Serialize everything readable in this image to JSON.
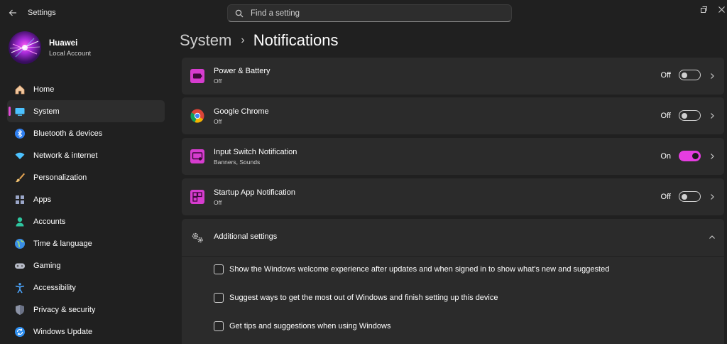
{
  "window": {
    "title": "Settings"
  },
  "search": {
    "placeholder": "Find a setting"
  },
  "profile": {
    "name": "Huawei",
    "account_type": "Local Account"
  },
  "sidebar": {
    "items": [
      {
        "label": "Home",
        "icon": "home-icon"
      },
      {
        "label": "System",
        "icon": "system-icon",
        "active": true
      },
      {
        "label": "Bluetooth & devices",
        "icon": "bluetooth-icon"
      },
      {
        "label": "Network & internet",
        "icon": "wifi-icon"
      },
      {
        "label": "Personalization",
        "icon": "brush-icon"
      },
      {
        "label": "Apps",
        "icon": "apps-icon"
      },
      {
        "label": "Accounts",
        "icon": "account-icon"
      },
      {
        "label": "Time & language",
        "icon": "globe-icon"
      },
      {
        "label": "Gaming",
        "icon": "gamepad-icon"
      },
      {
        "label": "Accessibility",
        "icon": "accessibility-icon"
      },
      {
        "label": "Privacy & security",
        "icon": "shield-icon"
      },
      {
        "label": "Windows Update",
        "icon": "update-icon"
      }
    ]
  },
  "breadcrumb": {
    "parent": "System",
    "separator": "›",
    "current": "Notifications"
  },
  "apps": [
    {
      "name": "Power & Battery",
      "detail": "Off",
      "state": "Off",
      "enabled": false,
      "icon": "battery-icon"
    },
    {
      "name": "Google Chrome",
      "detail": "Off",
      "state": "Off",
      "enabled": false,
      "icon": "chrome-icon"
    },
    {
      "name": "Input Switch Notification",
      "detail": "Banners, Sounds",
      "state": "On",
      "enabled": true,
      "icon": "input-switch-icon"
    },
    {
      "name": "Startup App Notification",
      "detail": "Off",
      "state": "Off",
      "enabled": false,
      "icon": "startup-app-icon"
    }
  ],
  "additional": {
    "title": "Additional settings",
    "options": [
      {
        "label": "Show the Windows welcome experience after updates and when signed in to show what's new and suggested",
        "checked": false
      },
      {
        "label": "Suggest ways to get the most out of Windows and finish setting up this device",
        "checked": false
      },
      {
        "label": "Get tips and suggestions when using Windows",
        "checked": false
      }
    ]
  },
  "colors": {
    "accent": "#e53de0",
    "background": "#202020",
    "card": "#2b2b2b"
  }
}
